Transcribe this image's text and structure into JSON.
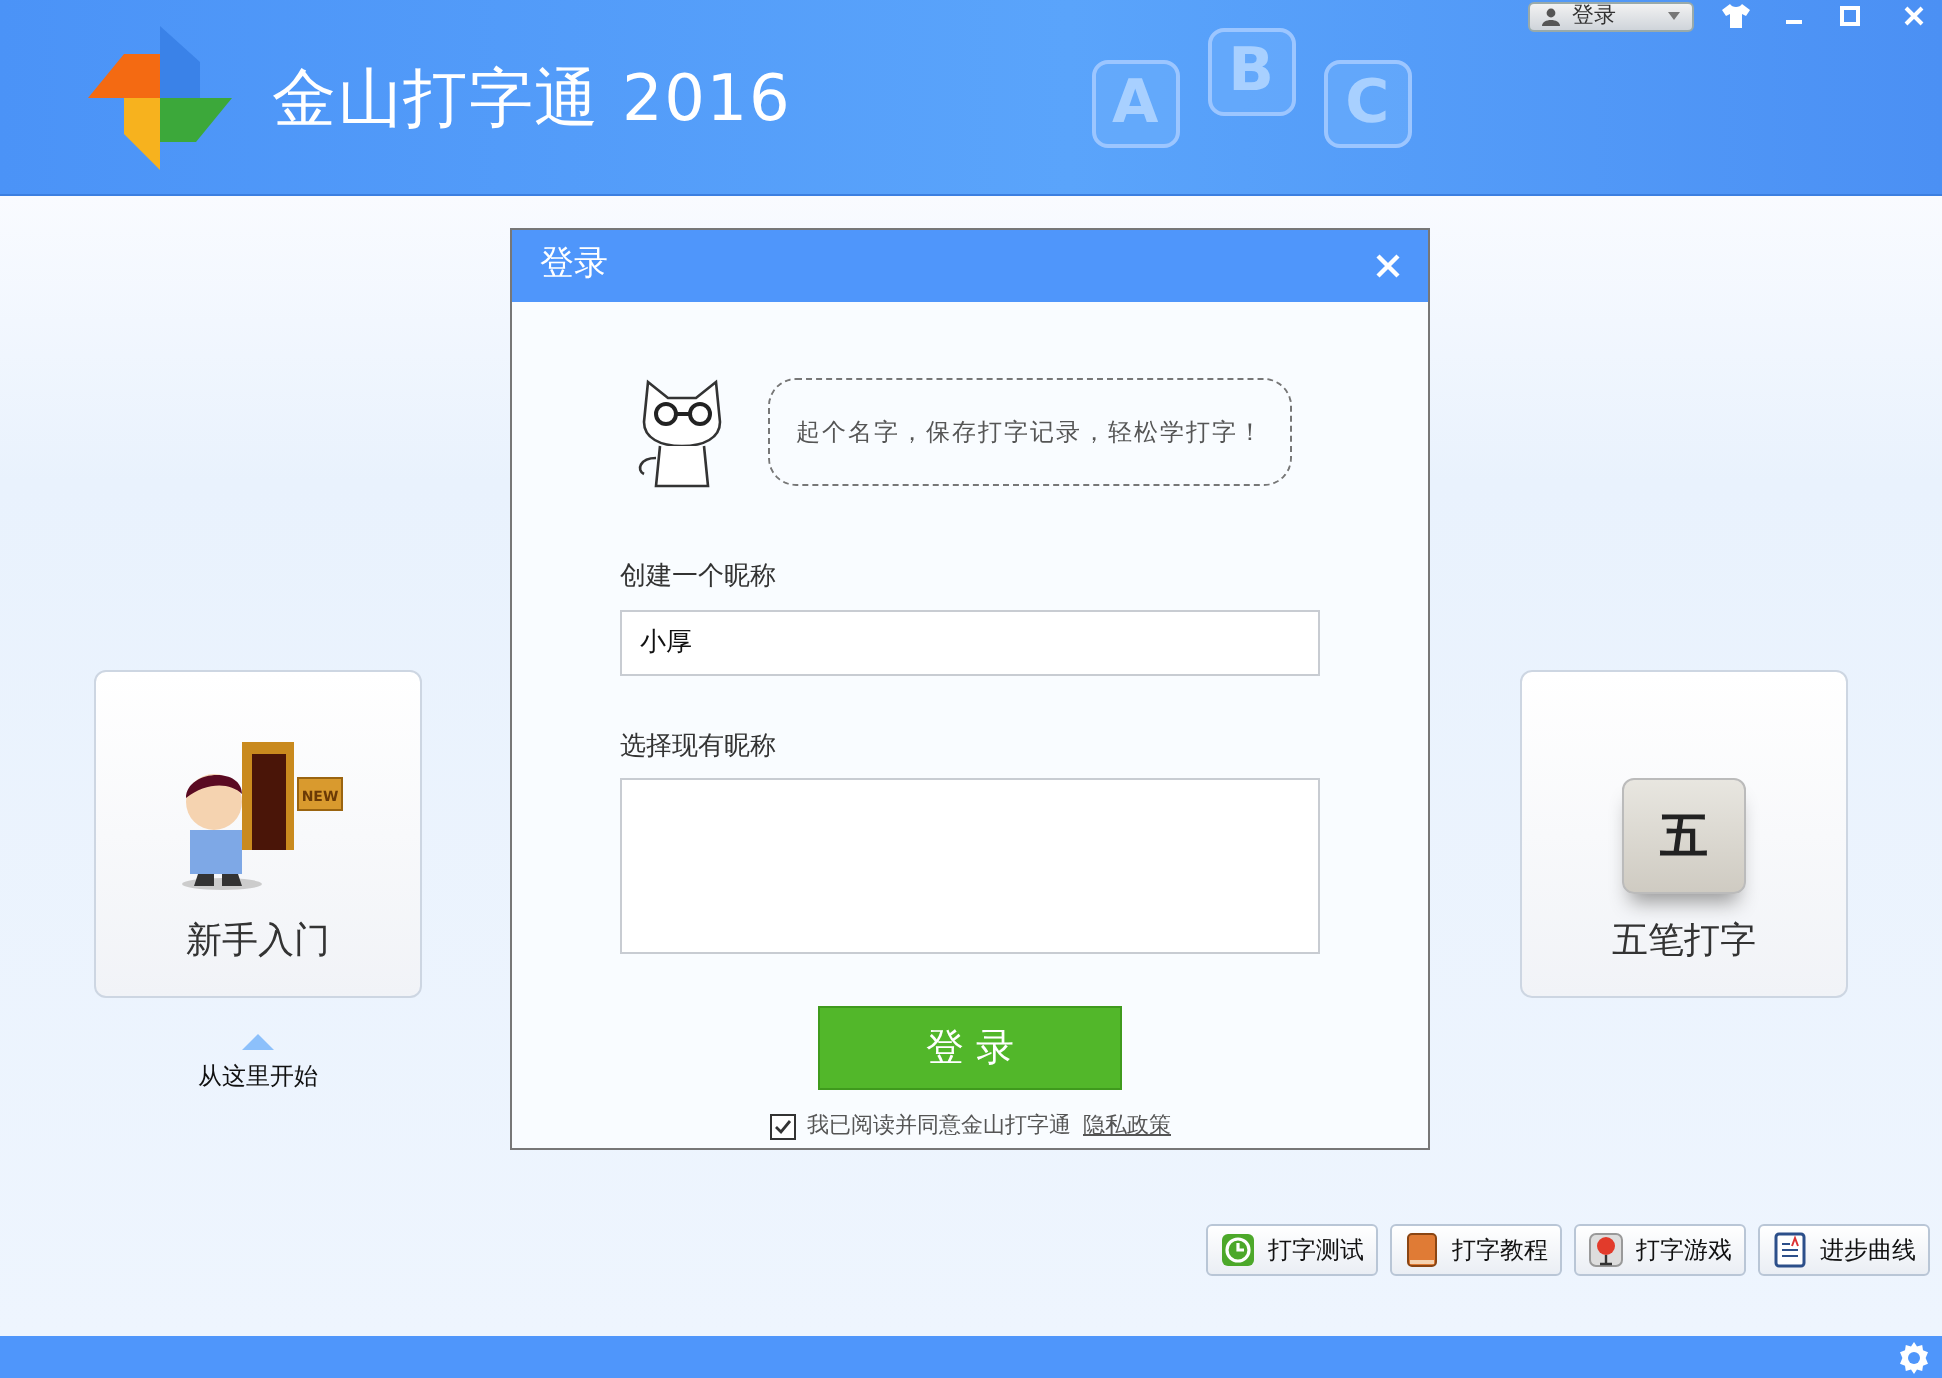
{
  "header": {
    "app_title": "金山打字通 2016",
    "decor_letters": [
      "A",
      "B",
      "C"
    ],
    "login_menu": "登录"
  },
  "cards": [
    {
      "kind": "beginner",
      "label": "新手入门",
      "sign_text": "NEW",
      "hint": "从这里开始"
    },
    {
      "kind": "wubi",
      "label": "五笔打字",
      "key_label": "五"
    }
  ],
  "dialog": {
    "title": "登录",
    "speech": "起个名字，保存打字记录，轻松学打字！",
    "nickname_label": "创建一个昵称",
    "nickname_value": "小厚",
    "existing_label": "选择现有昵称",
    "login_button": "登 录",
    "agree_checked": true,
    "agree_text": "我已阅读并同意金山打字通",
    "privacy_link": "隐私政策"
  },
  "tools": [
    {
      "kind": "clock",
      "label": "打字测试"
    },
    {
      "kind": "book",
      "label": "打字教程"
    },
    {
      "kind": "balloon",
      "label": "打字游戏"
    },
    {
      "kind": "chart",
      "label": "进步曲线"
    }
  ]
}
